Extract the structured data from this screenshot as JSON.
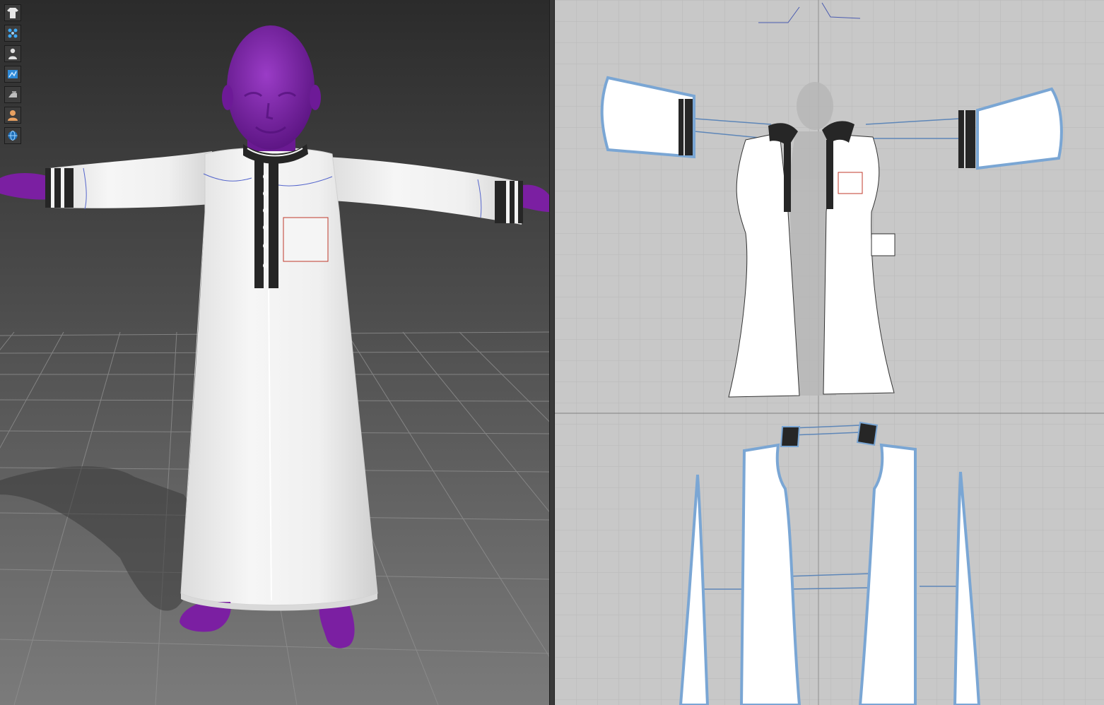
{
  "viewport_3d": {
    "toolbar": [
      {
        "icon": "garment-icon"
      },
      {
        "icon": "fabric-particles-icon"
      },
      {
        "icon": "avatar-silhouette-icon"
      },
      {
        "icon": "texture-map-icon"
      },
      {
        "icon": "iron-icon"
      },
      {
        "icon": "skin-shading-icon"
      },
      {
        "icon": "globe-render-icon"
      }
    ],
    "avatar_color": "#7b1fa2",
    "garment_color": "#f3f3f3",
    "trim_color": "#262626"
  },
  "pattern_2d": {
    "background_color": "#c8c8c8",
    "piece_outline_color": "#7aa6d4"
  }
}
